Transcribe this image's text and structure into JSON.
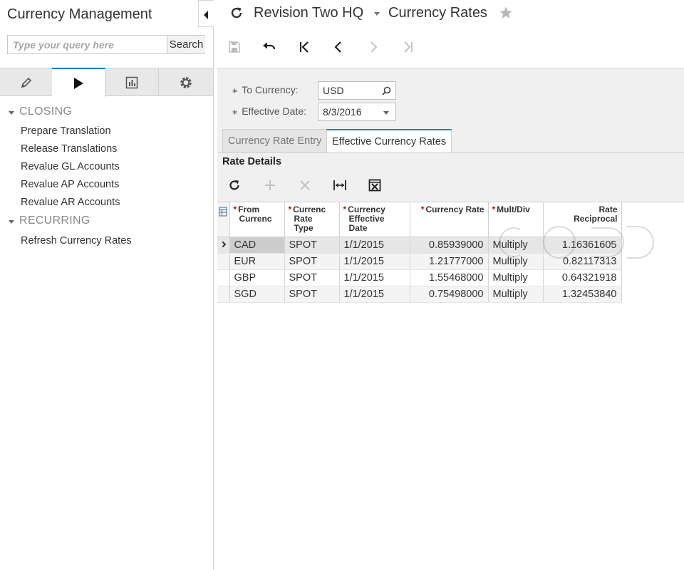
{
  "sidebar": {
    "title": "Currency Management",
    "search": {
      "placeholder": "Type your query here",
      "button_label": "Search"
    },
    "tabs": [
      {
        "icon": "pencil-icon"
      },
      {
        "icon": "play-icon",
        "active": true
      },
      {
        "icon": "chart-icon"
      },
      {
        "icon": "gear-icon"
      }
    ],
    "groups": [
      {
        "label": "CLOSING",
        "items": [
          "Prepare Translation",
          "Release Translations",
          "Revalue GL Accounts",
          "Revalue AP Accounts",
          "Revalue AR Accounts"
        ]
      },
      {
        "label": "RECURRING",
        "items": [
          "Refresh Currency Rates"
        ]
      }
    ]
  },
  "header": {
    "company": "Revision Two HQ",
    "screen_title": "Currency Rates"
  },
  "form": {
    "to_currency": {
      "label": "To Currency:",
      "value": "USD"
    },
    "effective_date": {
      "label": "Effective Date:",
      "value": "8/3/2016"
    },
    "tabs": [
      {
        "label": "Currency Rate Entry",
        "active": false
      },
      {
        "label": "Effective Currency Rates",
        "active": true
      }
    ]
  },
  "rate_details": {
    "title": "Rate Details",
    "columns": [
      {
        "key": "from",
        "label_lines": [
          "From",
          "Currenc"
        ],
        "required": true
      },
      {
        "key": "type",
        "label_lines": [
          "Currenc",
          "Rate",
          "Type"
        ],
        "required": true
      },
      {
        "key": "date",
        "label_lines": [
          "Currency",
          "Effective",
          "Date"
        ],
        "required": true
      },
      {
        "key": "rate",
        "label_lines": [
          "Currency Rate"
        ],
        "required": true
      },
      {
        "key": "mult",
        "label_lines": [
          "Mult/Div"
        ],
        "required": true
      },
      {
        "key": "recip",
        "label_lines": [
          "Rate",
          "Reciprocal"
        ],
        "required": false
      }
    ],
    "rows": [
      {
        "from": "CAD",
        "type": "SPOT",
        "date": "1/1/2015",
        "rate": "0.85939000",
        "mult": "Multiply",
        "recip": "1.16361605",
        "current": true
      },
      {
        "from": "EUR",
        "type": "SPOT",
        "date": "1/1/2015",
        "rate": "1.21777000",
        "mult": "Multiply",
        "recip": "0.82117313"
      },
      {
        "from": "GBP",
        "type": "SPOT",
        "date": "1/1/2015",
        "rate": "1.55468000",
        "mult": "Multiply",
        "recip": "0.64321918"
      },
      {
        "from": "SGD",
        "type": "SPOT",
        "date": "1/1/2015",
        "rate": "0.75498000",
        "mult": "Multiply",
        "recip": "1.32453840"
      }
    ]
  }
}
